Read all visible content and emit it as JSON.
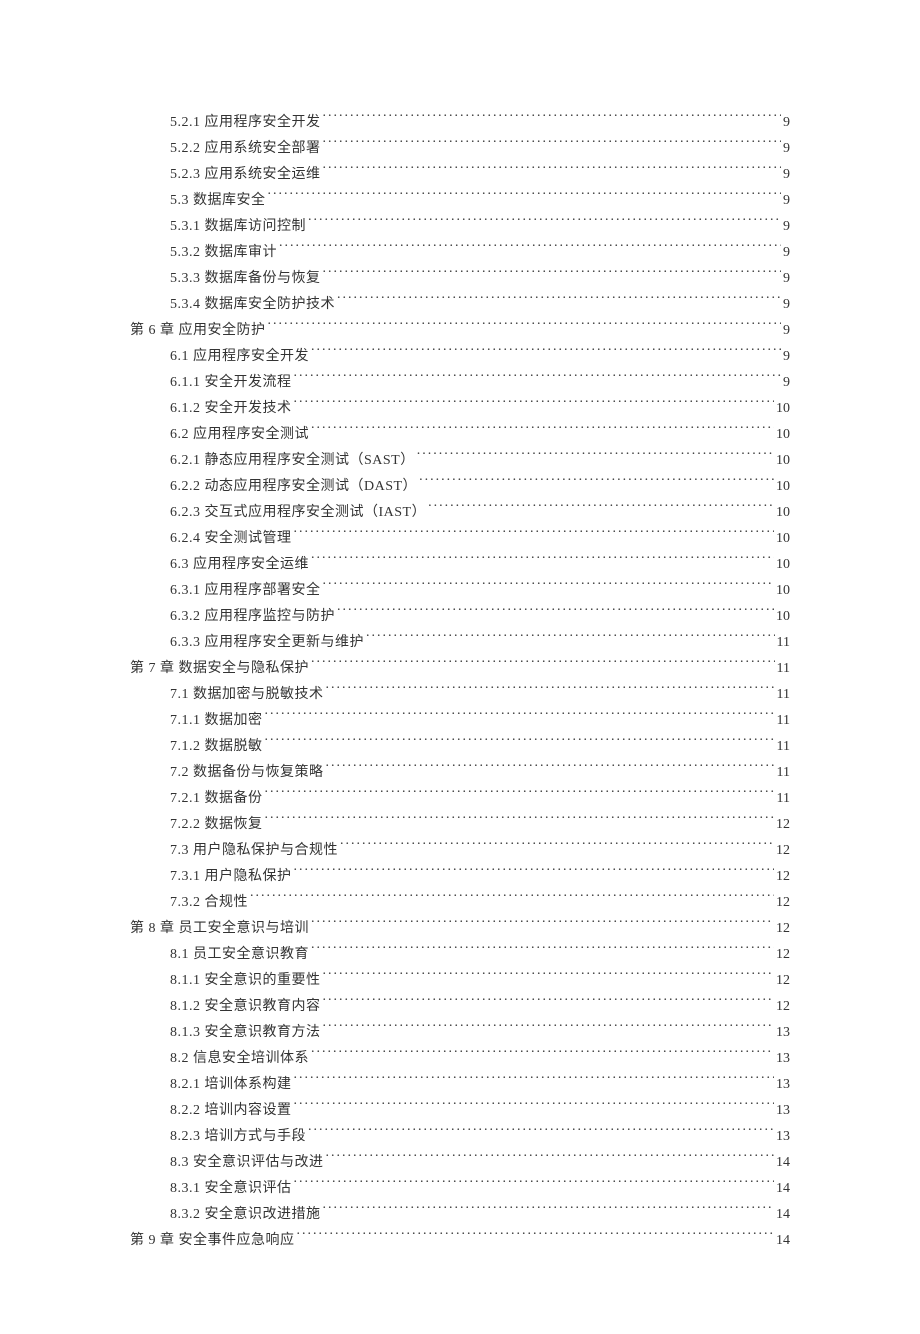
{
  "toc": [
    {
      "level": 3,
      "label": "5.2.1 应用程序安全开发",
      "page": "9"
    },
    {
      "level": 3,
      "label": "5.2.2 应用系统安全部署",
      "page": "9"
    },
    {
      "level": 3,
      "label": "5.2.3 应用系统安全运维",
      "page": "9"
    },
    {
      "level": 2,
      "label": "5.3 数据库安全",
      "page": "9"
    },
    {
      "level": 3,
      "label": "5.3.1 数据库访问控制",
      "page": "9"
    },
    {
      "level": 3,
      "label": "5.3.2 数据库审计",
      "page": "9"
    },
    {
      "level": 3,
      "label": "5.3.3 数据库备份与恢复",
      "page": "9"
    },
    {
      "level": 3,
      "label": "5.3.4 数据库安全防护技术",
      "page": "9"
    },
    {
      "level": 1,
      "label": "第 6 章 应用安全防护",
      "page": "9"
    },
    {
      "level": 2,
      "label": "6.1 应用程序安全开发",
      "page": "9"
    },
    {
      "level": 3,
      "label": "6.1.1 安全开发流程",
      "page": "9"
    },
    {
      "level": 3,
      "label": "6.1.2 安全开发技术",
      "page": "10"
    },
    {
      "level": 2,
      "label": "6.2 应用程序安全测试",
      "page": "10"
    },
    {
      "level": 3,
      "label": "6.2.1 静态应用程序安全测试（SAST）",
      "page": "10"
    },
    {
      "level": 3,
      "label": "6.2.2 动态应用程序安全测试（DAST）",
      "page": "10"
    },
    {
      "level": 3,
      "label": "6.2.3 交互式应用程序安全测试（IAST）",
      "page": "10"
    },
    {
      "level": 3,
      "label": "6.2.4 安全测试管理",
      "page": "10"
    },
    {
      "level": 2,
      "label": "6.3 应用程序安全运维",
      "page": "10"
    },
    {
      "level": 3,
      "label": "6.3.1 应用程序部署安全",
      "page": "10"
    },
    {
      "level": 3,
      "label": "6.3.2 应用程序监控与防护",
      "page": "10"
    },
    {
      "level": 3,
      "label": "6.3.3 应用程序安全更新与维护",
      "page": "11"
    },
    {
      "level": 1,
      "label": "第 7 章 数据安全与隐私保护",
      "page": "11"
    },
    {
      "level": 2,
      "label": "7.1 数据加密与脱敏技术",
      "page": "11"
    },
    {
      "level": 3,
      "label": "7.1.1 数据加密 ",
      "page": "11"
    },
    {
      "level": 3,
      "label": "7.1.2 数据脱敏 ",
      "page": "11"
    },
    {
      "level": 2,
      "label": "7.2 数据备份与恢复策略",
      "page": "11"
    },
    {
      "level": 3,
      "label": "7.2.1 数据备份 ",
      "page": "11"
    },
    {
      "level": 3,
      "label": "7.2.2 数据恢复 ",
      "page": "12"
    },
    {
      "level": 2,
      "label": "7.3 用户隐私保护与合规性",
      "page": "12"
    },
    {
      "level": 3,
      "label": "7.3.1 用户隐私保护",
      "page": "12"
    },
    {
      "level": 3,
      "label": "7.3.2 合规性 ",
      "page": "12"
    },
    {
      "level": 1,
      "label": "第 8 章 员工安全意识与培训",
      "page": "12"
    },
    {
      "level": 2,
      "label": "8.1 员工安全意识教育",
      "page": "12"
    },
    {
      "level": 3,
      "label": "8.1.1 安全意识的重要性",
      "page": "12"
    },
    {
      "level": 3,
      "label": "8.1.2 安全意识教育内容",
      "page": "12"
    },
    {
      "level": 3,
      "label": "8.1.3 安全意识教育方法",
      "page": "13"
    },
    {
      "level": 2,
      "label": "8.2 信息安全培训体系",
      "page": "13"
    },
    {
      "level": 3,
      "label": "8.2.1 培训体系构建",
      "page": "13"
    },
    {
      "level": 3,
      "label": "8.2.2 培训内容设置",
      "page": "13"
    },
    {
      "level": 3,
      "label": "8.2.3 培训方式与手段",
      "page": "13"
    },
    {
      "level": 2,
      "label": "8.3 安全意识评估与改进",
      "page": "14"
    },
    {
      "level": 3,
      "label": "8.3.1 安全意识评估",
      "page": "14"
    },
    {
      "level": 3,
      "label": "8.3.2 安全意识改进措施",
      "page": "14"
    },
    {
      "level": 1,
      "label": "第 9 章 安全事件应急响应",
      "page": "14"
    }
  ]
}
